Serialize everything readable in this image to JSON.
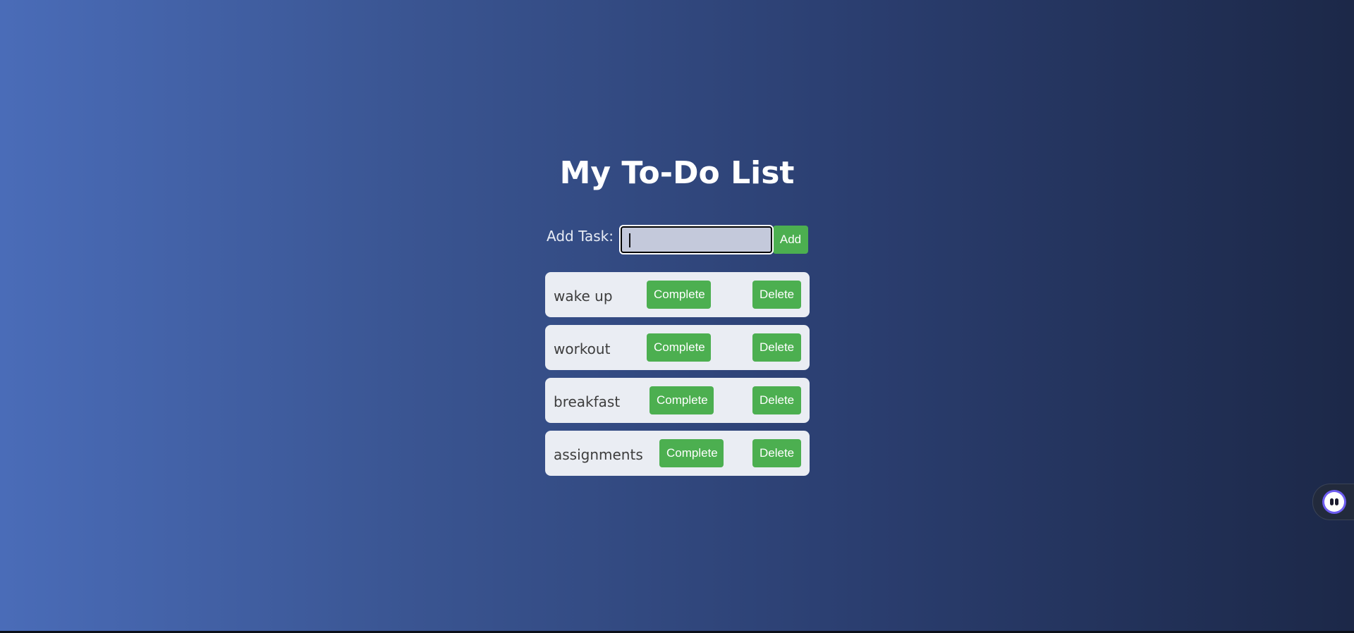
{
  "app": {
    "title": "My To-Do List"
  },
  "add_task": {
    "label": "Add Task:",
    "input_value": "",
    "button_label": "Add"
  },
  "tasks": [
    {
      "text": "wake up",
      "complete_label": "Complete",
      "delete_label": "Delete"
    },
    {
      "text": "workout",
      "complete_label": "Complete",
      "delete_label": "Delete"
    },
    {
      "text": "breakfast",
      "complete_label": "Complete",
      "delete_label": "Delete"
    },
    {
      "text": "assignments",
      "complete_label": "Complete",
      "delete_label": "Delete"
    }
  ],
  "colors": {
    "accent": "#4caf50",
    "background_start": "#4a6cb8",
    "background_end": "#1c2848",
    "card": "#eaedf3"
  },
  "assistant": {
    "icon": "assistant-bot-icon"
  }
}
